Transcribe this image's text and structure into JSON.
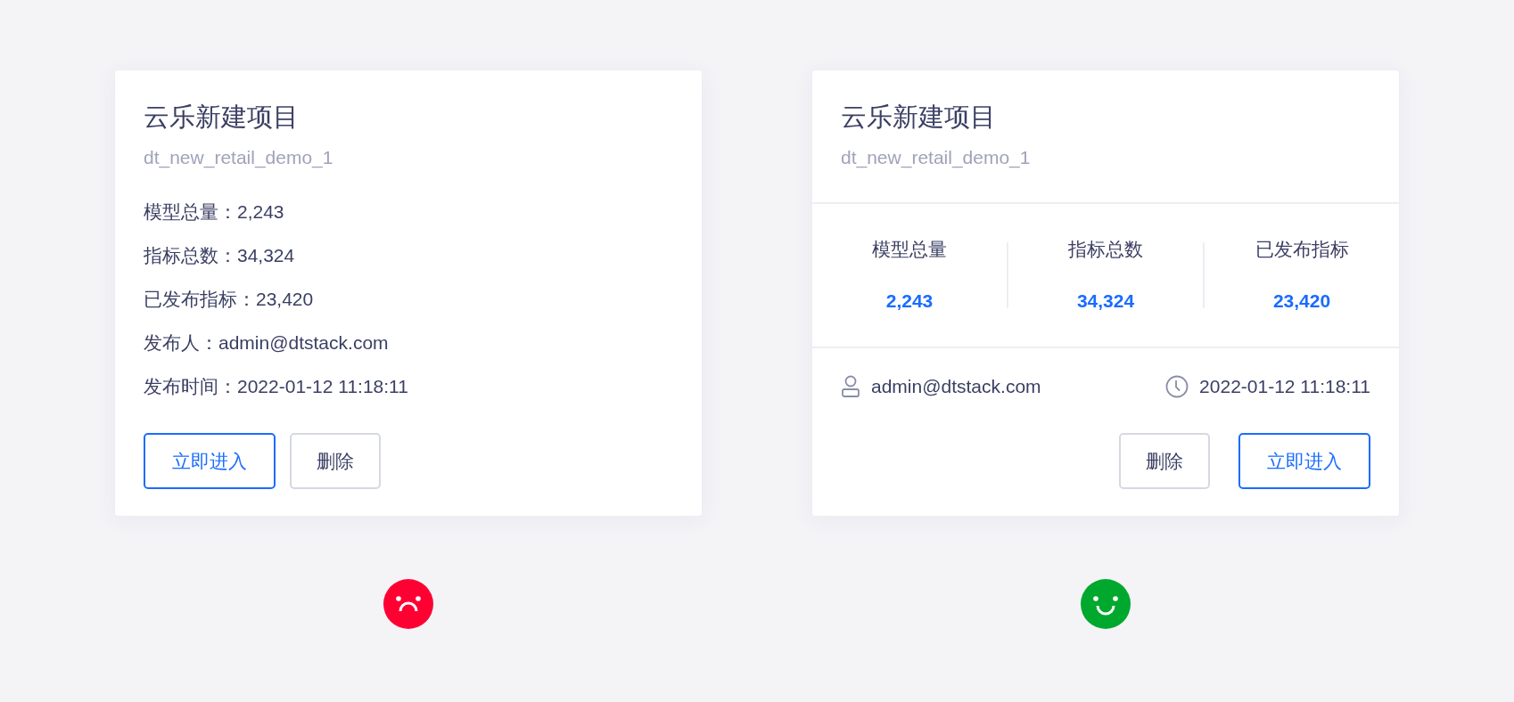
{
  "cards": [
    {
      "kind": "list",
      "title": "云乐新建项目",
      "code": "dt_new_retail_demo_1",
      "lines": [
        {
          "text": "模型总量：2,243"
        },
        {
          "text": "指标总数：34,324"
        },
        {
          "text": "已发布指标：23,420"
        },
        {
          "text": "发布人：admin@dtstack.com"
        },
        {
          "text": "发布时间：2022-01-12 11:18:11"
        }
      ],
      "buttons": [
        {
          "label": "立即进入",
          "kind": "primary"
        },
        {
          "label": "删除",
          "kind": "default"
        }
      ],
      "face": {
        "kind": "sad",
        "color": "#ff0033"
      }
    },
    {
      "kind": "stats",
      "title": "云乐新建项目",
      "code": "dt_new_retail_demo_1",
      "stats": [
        {
          "label": "模型总量",
          "value": "2,243"
        },
        {
          "label": "指标总数",
          "value": "34,324"
        },
        {
          "label": "已发布指标",
          "value": "23,420"
        }
      ],
      "meta": [
        {
          "kind": "user",
          "text": "admin@dtstack.com"
        },
        {
          "kind": "clock",
          "text": "2022-01-12 11:18:11"
        }
      ],
      "buttons": [
        {
          "label": "删除",
          "kind": "default"
        },
        {
          "label": "立即进入",
          "kind": "primary"
        }
      ],
      "face": {
        "kind": "happy",
        "color": "#00a82d"
      }
    }
  ]
}
